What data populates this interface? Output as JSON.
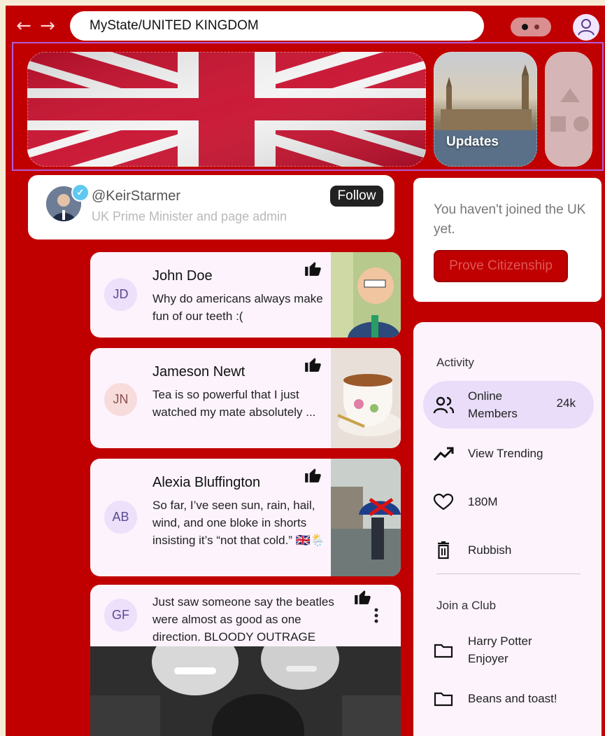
{
  "header": {
    "address": "MyState/UNITED KINGDOM"
  },
  "carousel": {
    "tiles": [
      {
        "caption": ""
      },
      {
        "caption": "Updates"
      },
      {
        "caption": ""
      }
    ]
  },
  "admin": {
    "handle": "@KeirStarmer",
    "description": "UK Prime Minister and page admin",
    "follow_label": "Follow"
  },
  "join": {
    "message": "You haven't joined the UK yet.",
    "button_label": "Prove Citizenship"
  },
  "posts": [
    {
      "initials": "JD",
      "name": "John Doe",
      "text": "Why do americans always make fun of our teeth :("
    },
    {
      "initials": "JN",
      "name": "Jameson Newt",
      "text": "Tea is so powerful that I just watched my mate absolutely ..."
    },
    {
      "initials": "AB",
      "name": "Alexia Bluffington",
      "text": "So far, I’ve seen sun, rain, hail, wind, and one bloke in shorts insisting it’s “not that cold.” 🇬🇧🌦️"
    },
    {
      "initials": "GF",
      "name": "",
      "text": "Just saw someone say the beatles were almost as good as one direction. BLOODY OUTRAGE"
    }
  ],
  "sidebar": {
    "activity_heading": "Activity",
    "items": [
      {
        "label": "Online Members",
        "count": "24k",
        "icon": "group-icon"
      },
      {
        "label": "View Trending",
        "icon": "trending-up-icon"
      },
      {
        "label": "180M",
        "icon": "heart-icon"
      },
      {
        "label": "Rubbish",
        "icon": "trash-icon"
      }
    ],
    "club_heading": "Join a Club",
    "clubs": [
      {
        "label": "Harry Potter Enjoyer",
        "icon": "folder-icon"
      },
      {
        "label": "Beans and toast!",
        "icon": "folder-icon"
      }
    ]
  },
  "colors": {
    "background": "#c00000",
    "card": "#fcf3fc",
    "accent": "#e9ddf9",
    "avatar_purple": "#ece0fb",
    "avatar_pink": "#f8dcdc"
  }
}
